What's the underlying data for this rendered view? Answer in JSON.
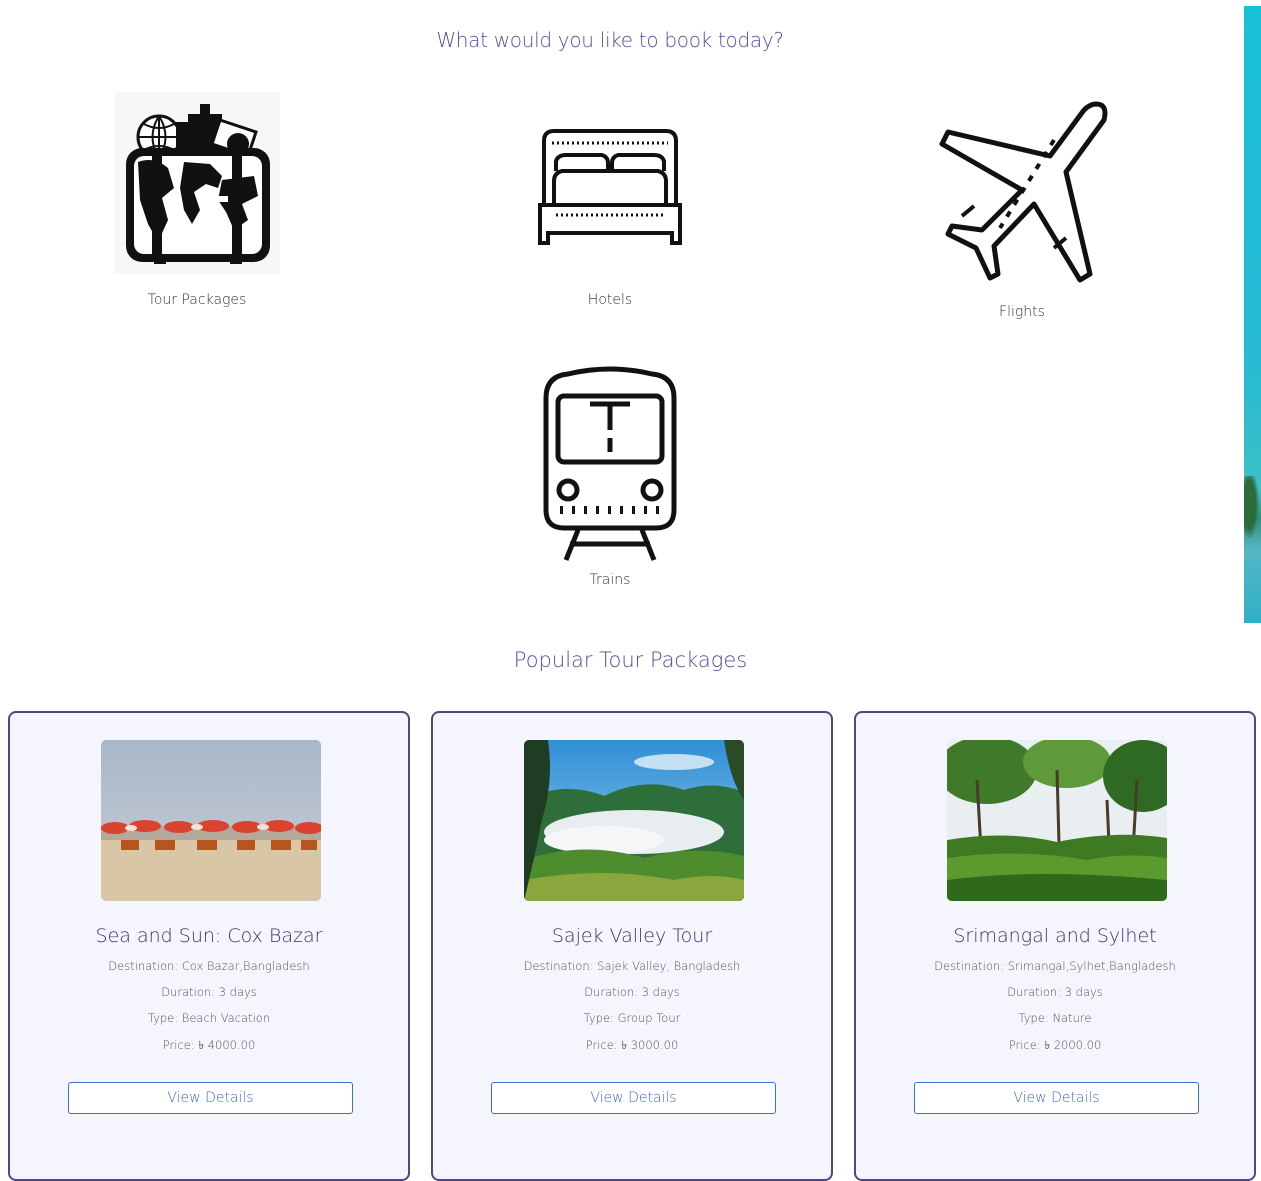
{
  "booking": {
    "heading": "What would you like to book today?",
    "options": [
      {
        "label": "Tour Packages",
        "icon": "suitcase-globe-icon"
      },
      {
        "label": "Hotels",
        "icon": "bed-icon"
      },
      {
        "label": "Flights",
        "icon": "airplane-icon"
      },
      {
        "label": "Trains",
        "icon": "train-icon"
      }
    ]
  },
  "popular": {
    "title": "Popular Tour Packages",
    "cards": [
      {
        "title": "Sea and Sun: Cox Bazar",
        "destination": "Destination: Cox Bazar,Bangladesh",
        "duration": "Duration: 3 days",
        "type": "Type: Beach Vacation",
        "price": "Price: ৳ 4000.00",
        "button": "View Details"
      },
      {
        "title": "Sajek Valley Tour",
        "destination": "Destination: Sajek Valley, Bangladesh",
        "duration": "Duration: 3 days",
        "type": "Type: Group Tour",
        "price": "Price: ৳ 3000.00",
        "button": "View Details"
      },
      {
        "title": "Srimangal and Sylhet",
        "destination": "Destination: Srimangal,Sylhet,Bangladesh",
        "duration": "Duration: 3 days",
        "type": "Type: Nature",
        "price": "Price: ৳ 2000.00",
        "button": "View Details"
      }
    ]
  },
  "colors": {
    "heading": "#5a4b9a",
    "card_border": "#4f477f",
    "card_bg": "#f5f5fd",
    "button": "#3c6fd1"
  }
}
